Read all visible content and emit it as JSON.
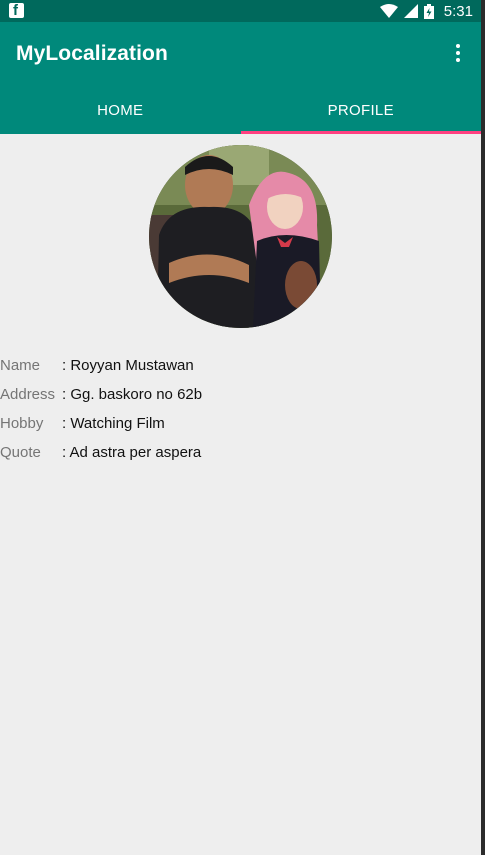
{
  "status_bar": {
    "time": "5:31",
    "icons": [
      "facebook-icon",
      "wifi-icon",
      "cell-signal-icon",
      "battery-icon"
    ]
  },
  "app_bar": {
    "title": "MyLocalization",
    "overflow_icon": "more-vert-icon"
  },
  "tabs": [
    {
      "label": "HOME",
      "selected": false
    },
    {
      "label": "PROFILE",
      "selected": true
    }
  ],
  "colors": {
    "status_bar": "#00695c",
    "primary": "#00897b",
    "accent": "#ff4081",
    "background": "#eeeeee"
  },
  "profile": {
    "rows": [
      {
        "label": "Name",
        "value": ": Royyan Mustawan"
      },
      {
        "label": "Address",
        "value": ": Gg. baskoro no 62b"
      },
      {
        "label": "Hobby",
        "value": ": Watching Film"
      },
      {
        "label": "Quote",
        "value": ": Ad astra per aspera"
      }
    ]
  }
}
